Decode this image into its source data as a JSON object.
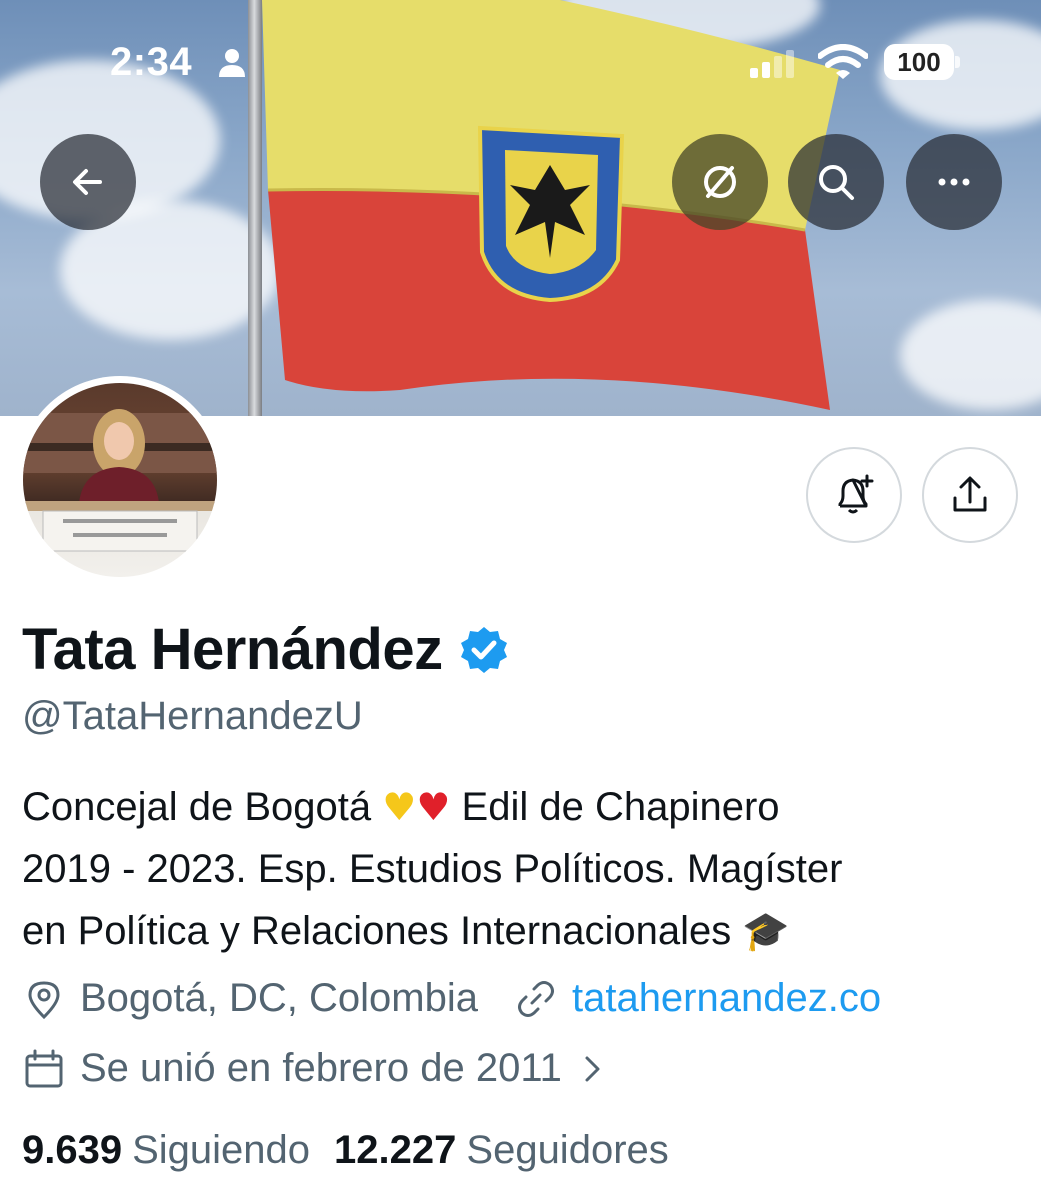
{
  "status_bar": {
    "time": "2:34",
    "battery": "100"
  },
  "banner": {
    "description_icons": [
      "back-arrow-icon",
      "translate-off-icon",
      "search-icon",
      "more-icon"
    ]
  },
  "profile": {
    "name": "Tata Hernández",
    "handle": "@TataHernandezU",
    "verified": true,
    "bio": {
      "line1_a": "Concejal de Bogotá",
      "line1_b": "Edil de Chapinero",
      "line2": "2019 - 2023. Esp. Estudios Políticos. Magíster",
      "line3": "en Política y Relaciones Internacionales",
      "emoji_yellow_heart": "♥",
      "emoji_red_heart": "♥",
      "emoji_cap": "🎓"
    },
    "location": "Bogotá, DC, Colombia",
    "website": "tatahernandez.co",
    "joined": "Se unió en febrero de 2011",
    "following_count": "9.639",
    "following_label": "Siguiendo",
    "followers_count": "12.227",
    "followers_label": "Seguidores"
  },
  "colors": {
    "accent": "#1d9bf0",
    "text_primary": "#0f1419",
    "text_secondary": "#536471",
    "flag_yellow": "#e6dd6a",
    "flag_red": "#d9443a"
  }
}
